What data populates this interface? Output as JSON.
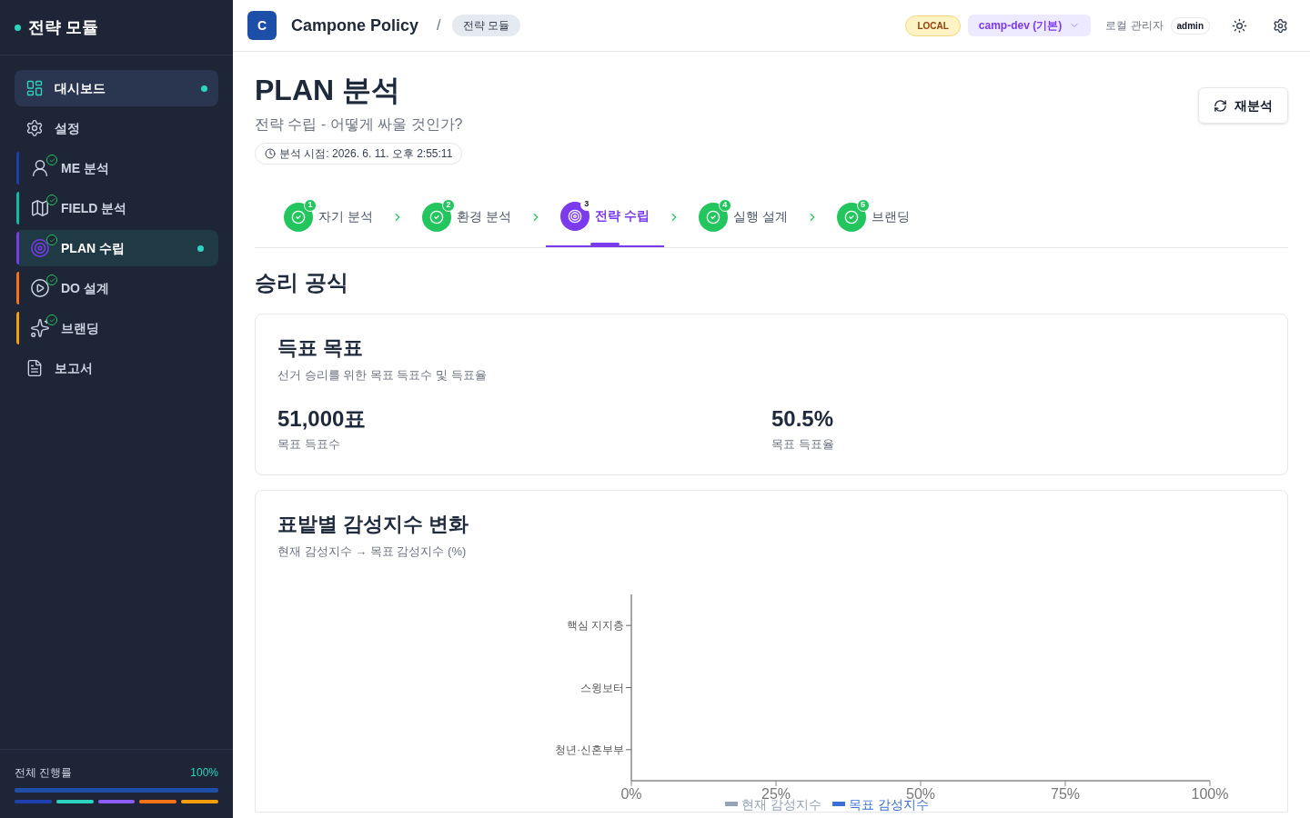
{
  "sidebar": {
    "title": "전략 모듈",
    "items": [
      {
        "kind": "nav",
        "label": "대시보드",
        "selected": true
      },
      {
        "kind": "nav",
        "label": "설정",
        "selected": false
      },
      {
        "kind": "module",
        "label": "ME 분석",
        "color": "#1e40af",
        "done": true,
        "selected": false
      },
      {
        "kind": "module",
        "label": "FIELD 분석",
        "color": "#14b8a6",
        "done": true,
        "selected": false
      },
      {
        "kind": "module",
        "label": "PLAN 수립",
        "color": "#7c3aed",
        "done": true,
        "selected": true
      },
      {
        "kind": "module",
        "label": "DO 설계",
        "color": "#f97316",
        "done": true,
        "selected": false
      },
      {
        "kind": "module",
        "label": "브랜딩",
        "color": "#f59e0b",
        "done": true,
        "selected": false
      },
      {
        "kind": "nav",
        "label": "보고서",
        "selected": false
      }
    ],
    "progress": {
      "label": "전체 진행률",
      "reading": "100%",
      "level": 1,
      "segments": [
        {
          "color": "#1e40af",
          "level": 1
        },
        {
          "color": "#2dd4bf",
          "level": 1
        },
        {
          "color": "#8b5cf6",
          "level": 1
        },
        {
          "color": "#f97316",
          "level": 1
        },
        {
          "color": "#f59e0b",
          "level": 1
        }
      ]
    }
  },
  "header": {
    "logo": "C",
    "app_name": "Campone Policy",
    "separator": "/",
    "breadcrumb": "전략 모듈",
    "environment": "LOCAL",
    "workspace": "camp-dev (기본)",
    "user": "로컬 관리자",
    "role": "admin"
  },
  "page": {
    "title": "PLAN 분석",
    "subtitle": "전략 수립 - 어떻게 싸울 것인가?",
    "timestamp": "분석 시점: 2026. 6. 11. 오후 2:55:11",
    "reanalyze_button": "재분석"
  },
  "steps": [
    {
      "number": "1",
      "label": "자기 분석",
      "done": true,
      "selected": false
    },
    {
      "number": "2",
      "label": "환경 분석",
      "done": true,
      "selected": false
    },
    {
      "number": "3",
      "label": "전략 수립",
      "done": false,
      "selected": true
    },
    {
      "number": "4",
      "label": "실행 설계",
      "done": true,
      "selected": false
    },
    {
      "number": "5",
      "label": "브랜딩",
      "done": true,
      "selected": false
    }
  ],
  "section_title": "승리 공식",
  "vote_goal": {
    "title": "득표 목표",
    "subtitle": "선거 승리를 위한 목표 득표수 및 득표율",
    "stats": [
      {
        "value": "51,000표",
        "label": "목표 득표수"
      },
      {
        "value": "50.5%",
        "label": "목표 득표율"
      }
    ]
  },
  "sentiment": {
    "title": "표밭별 감성지수 변화",
    "subtitle": "현재 감성지수 → 목표 감성지수 (%)",
    "chart_data": {
      "type": "bar",
      "orientation": "horizontal",
      "categories": [
        "핵심 지지층",
        "스윙보터",
        "청년·신혼부부"
      ],
      "series": [
        {
          "name": "현재 감성지수",
          "color": "#94a3b8",
          "values": [
            null,
            null,
            null
          ]
        },
        {
          "name": "목표 감성지수",
          "color": "#3b6fd6",
          "values": [
            null,
            null,
            null
          ]
        }
      ],
      "xlim": [
        0,
        100
      ],
      "xticks": [
        {
          "value": 0,
          "label": "0%"
        },
        {
          "value": 25,
          "label": "25%"
        },
        {
          "value": 50,
          "label": "50%"
        },
        {
          "value": 75,
          "label": "75%"
        },
        {
          "value": 100,
          "label": "100%"
        }
      ]
    }
  }
}
